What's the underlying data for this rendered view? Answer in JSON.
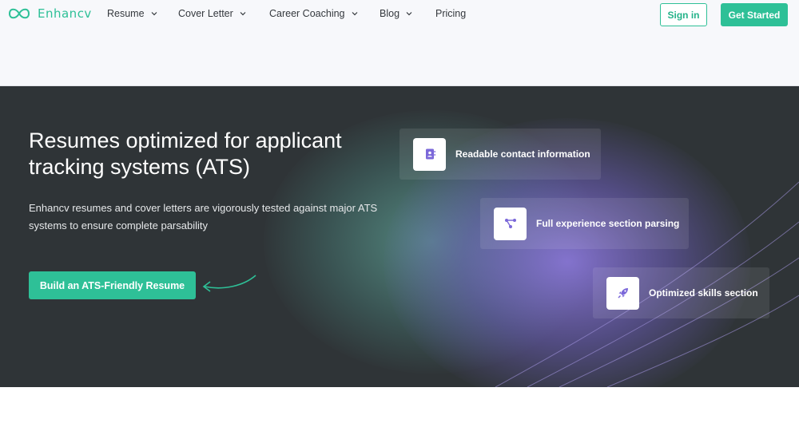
{
  "nav": {
    "logo_text": "Enhancv",
    "items": [
      {
        "label": "Resume",
        "has_dropdown": true
      },
      {
        "label": "Cover Letter",
        "has_dropdown": true
      },
      {
        "label": "Career Coaching",
        "has_dropdown": true
      },
      {
        "label": "Blog",
        "has_dropdown": true
      },
      {
        "label": "Pricing",
        "has_dropdown": false
      }
    ],
    "signin_label": "Sign in",
    "get_started_label": "Get Started"
  },
  "hero": {
    "title": "Resumes optimized for applicant tracking systems (ATS)",
    "description": "Enhancv resumes and cover letters are vigorously tested against major ATS systems to ensure complete parsability",
    "cta_label": "Build an ATS-Friendly Resume",
    "features": [
      {
        "label": "Readable contact information",
        "icon": "contact-card-icon"
      },
      {
        "label": "Full experience section parsing",
        "icon": "nodes-icon"
      },
      {
        "label": "Optimized skills section",
        "icon": "rocket-icon"
      }
    ]
  },
  "colors": {
    "brand_green": "#2ec097",
    "hero_bg": "#2f3437",
    "accent_purple": "#7b68d9",
    "nav_bg": "#f7f8fb"
  }
}
